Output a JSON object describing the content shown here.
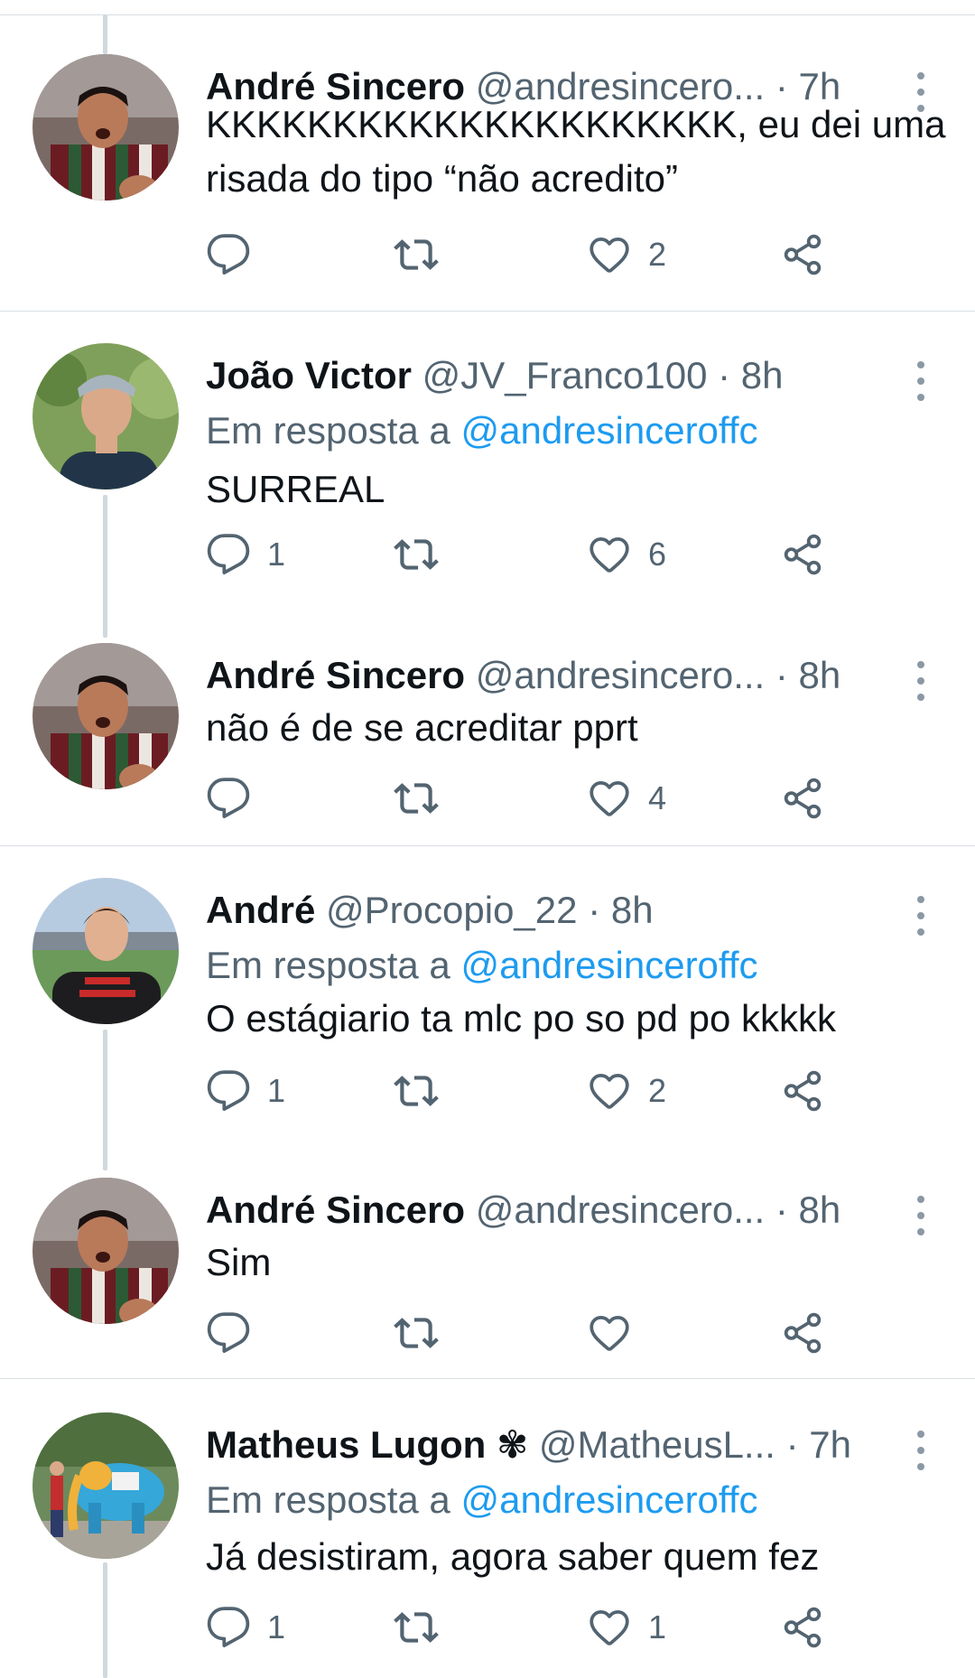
{
  "tweets": [
    {
      "name": "André Sincero",
      "handle": "@andresincero...",
      "time": "· 7h",
      "reply_label": "",
      "reply_handle": "",
      "text": "KKKKKKKKKKKKKKKKKKKKK, eu dei uma risada do tipo “não acredito”",
      "replies": "",
      "retweets": "",
      "likes": "2",
      "avatar": "andre-sincero"
    },
    {
      "name": "João Victor",
      "handle": "@JV_Franco100",
      "time": "· 8h",
      "reply_label": "Em resposta a",
      "reply_handle": "@andresinceroffc",
      "text": "SURREAL",
      "replies": "1",
      "retweets": "",
      "likes": "6",
      "avatar": "joao-victor"
    },
    {
      "name": "André Sincero",
      "handle": "@andresincero...",
      "time": "· 8h",
      "reply_label": "",
      "reply_handle": "",
      "text": "não é de se acreditar pprt",
      "replies": "",
      "retweets": "",
      "likes": "4",
      "avatar": "andre-sincero"
    },
    {
      "name": "André",
      "handle": "@Procopio_22",
      "time": "· 8h",
      "reply_label": "Em resposta a",
      "reply_handle": "@andresinceroffc",
      "text": "O estágiario ta mlc po so pd po kkkkk",
      "replies": "1",
      "retweets": "",
      "likes": "2",
      "avatar": "andre-procopio"
    },
    {
      "name": "André Sincero",
      "handle": "@andresincero...",
      "time": "· 8h",
      "reply_label": "",
      "reply_handle": "",
      "text": "Sim",
      "replies": "",
      "retweets": "",
      "likes": "",
      "avatar": "andre-sincero"
    },
    {
      "name": "Matheus Lugon ✾",
      "handle": "@MatheusL...",
      "time": "· 7h",
      "reply_label": "Em resposta a",
      "reply_handle": "@andresinceroffc",
      "text": "Já desistiram, agora saber quem fez",
      "replies": "1",
      "retweets": "",
      "likes": "1",
      "avatar": "matheus-lugon"
    }
  ],
  "icons": {
    "reply": "reply-icon",
    "retweet": "retweet-icon",
    "like": "heart-icon",
    "share": "share-icon",
    "more": "more-options-icon"
  },
  "colors": {
    "link": "#1d9bf0",
    "secondary_text": "#536471",
    "primary_text": "#0f1419",
    "divider": "#d9dee3",
    "thread_line": "#cfd9de"
  }
}
